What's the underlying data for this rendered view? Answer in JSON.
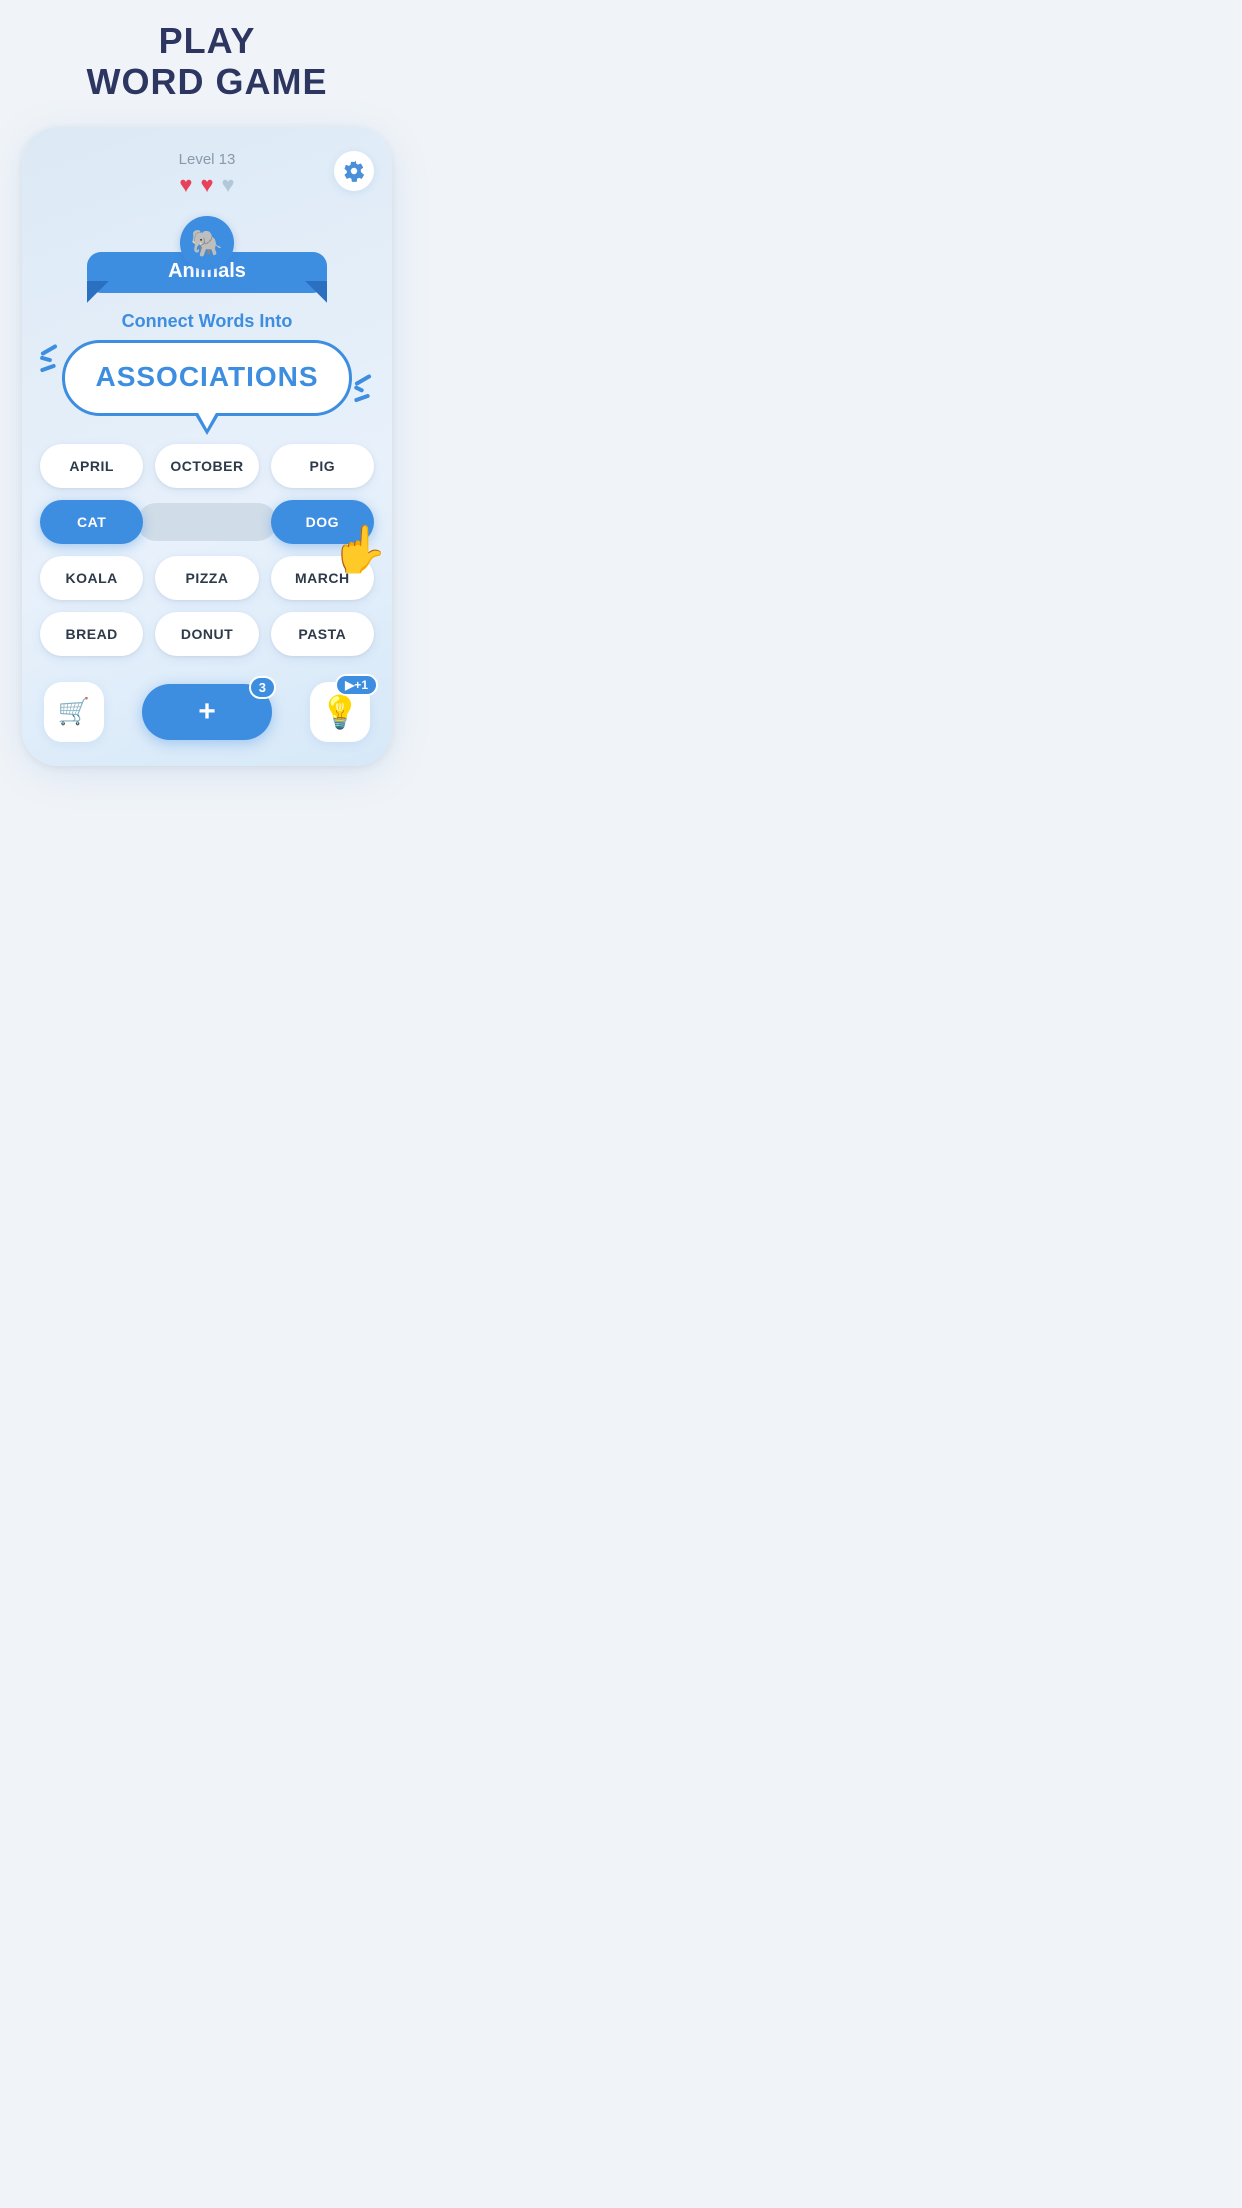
{
  "header": {
    "title_line1": "PLAY",
    "title_line2": "WORD GAME"
  },
  "game": {
    "level_label": "Level 13",
    "hearts": [
      {
        "filled": true
      },
      {
        "filled": true
      },
      {
        "filled": false
      }
    ],
    "category": {
      "icon": "🐘",
      "label": "Animals"
    },
    "connect_text": "Connect Words Into",
    "associations_text": "ASSOCIATIONS",
    "words": [
      {
        "id": "april",
        "label": "APRIL",
        "selected": false,
        "row": 0,
        "col": 0
      },
      {
        "id": "october",
        "label": "OCTOBER",
        "selected": false,
        "row": 0,
        "col": 1
      },
      {
        "id": "pig",
        "label": "PIG",
        "selected": false,
        "row": 0,
        "col": 2
      },
      {
        "id": "cat",
        "label": "CAT",
        "selected": true,
        "row": 1,
        "col": 0
      },
      {
        "id": "middle",
        "label": "",
        "selected": false,
        "row": 1,
        "col": 1
      },
      {
        "id": "dog",
        "label": "DOG",
        "selected": true,
        "row": 1,
        "col": 2
      },
      {
        "id": "koala",
        "label": "KOALA",
        "selected": false,
        "row": 2,
        "col": 0
      },
      {
        "id": "pizza",
        "label": "PIZZA",
        "selected": false,
        "row": 2,
        "col": 1
      },
      {
        "id": "march",
        "label": "MARCH",
        "selected": false,
        "row": 2,
        "col": 2
      },
      {
        "id": "bread",
        "label": "BREAD",
        "selected": false,
        "row": 3,
        "col": 0
      },
      {
        "id": "donut",
        "label": "DONUT",
        "selected": false,
        "row": 3,
        "col": 1
      },
      {
        "id": "pasta",
        "label": "PASTA",
        "selected": false,
        "row": 3,
        "col": 2
      }
    ],
    "toolbar": {
      "shop_icon": "🛒",
      "plus_label": "+",
      "plus_count": "3",
      "hint_icon": "💡",
      "hint_badge": "▶+1"
    }
  }
}
